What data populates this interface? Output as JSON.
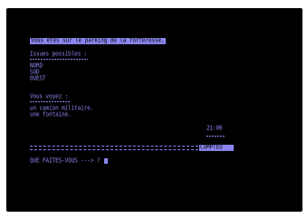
{
  "location": {
    "message": "Vous etes sur le parking de la forteresse."
  },
  "exits": {
    "heading": "Issues possibles :",
    "items": [
      "NORD",
      "SUD",
      "OUEST"
    ]
  },
  "visible": {
    "heading": "Vous voyez :",
    "items": [
      "un camion militaire.",
      "une fontaine."
    ]
  },
  "status": {
    "time": "21:06",
    "mode_label": "COMPTEU"
  },
  "prompt": {
    "text": "QUE FAITES-VOUS ---> ?"
  },
  "colors": {
    "screen": "#000000",
    "text": "#8c87f0",
    "frame": "#ffffff"
  }
}
